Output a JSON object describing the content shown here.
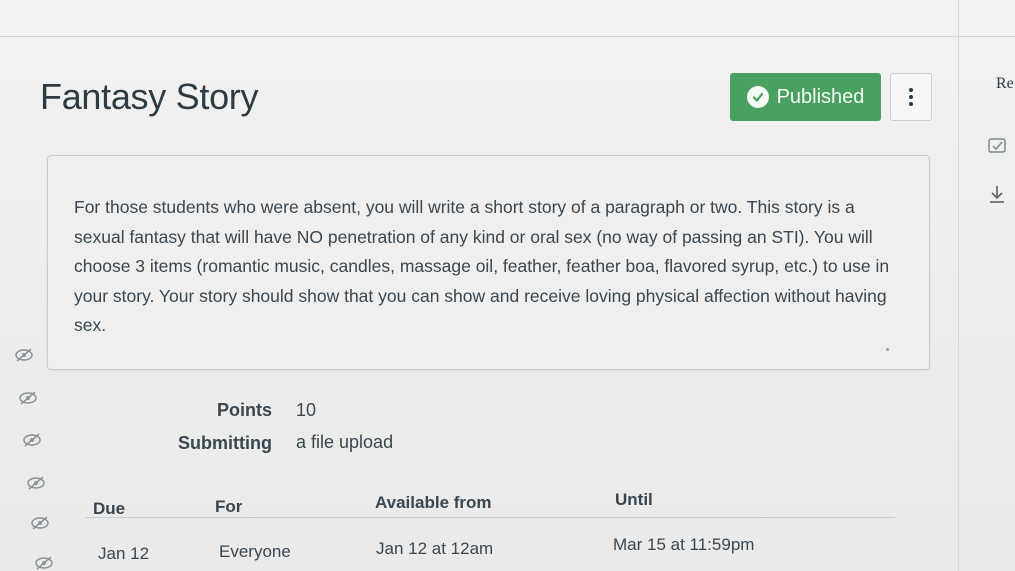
{
  "assignment": {
    "title": "Fantasy Story",
    "publish_label": "Published",
    "description": "For those students who were absent, you will write a short story of a paragraph or two. This story is a sexual fantasy that will have NO penetration of any kind or oral sex (no way of passing an STI). You will choose 3 items (romantic music, candles, massage oil, feather, feather boa, flavored syrup, etc.) to use in your story. Your story should show that you can show and receive loving physical affection without having sex."
  },
  "right_sidebar": {
    "label": "Re",
    "icons": [
      "rubric-icon",
      "download-icon"
    ]
  },
  "details": {
    "points_label": "Points",
    "points_value": "10",
    "submitting_label": "Submitting",
    "submitting_value": "a file upload"
  },
  "dates_table": {
    "headers": [
      "Due",
      "For",
      "Available from",
      "Until"
    ],
    "rows": [
      [
        "Jan 12",
        "Everyone",
        "Jan 12 at 12am",
        "Mar 15 at 11:59pm"
      ]
    ]
  },
  "colors": {
    "published_green": "#49a160",
    "text": "#2d3b45",
    "border": "#c7cdd1"
  }
}
